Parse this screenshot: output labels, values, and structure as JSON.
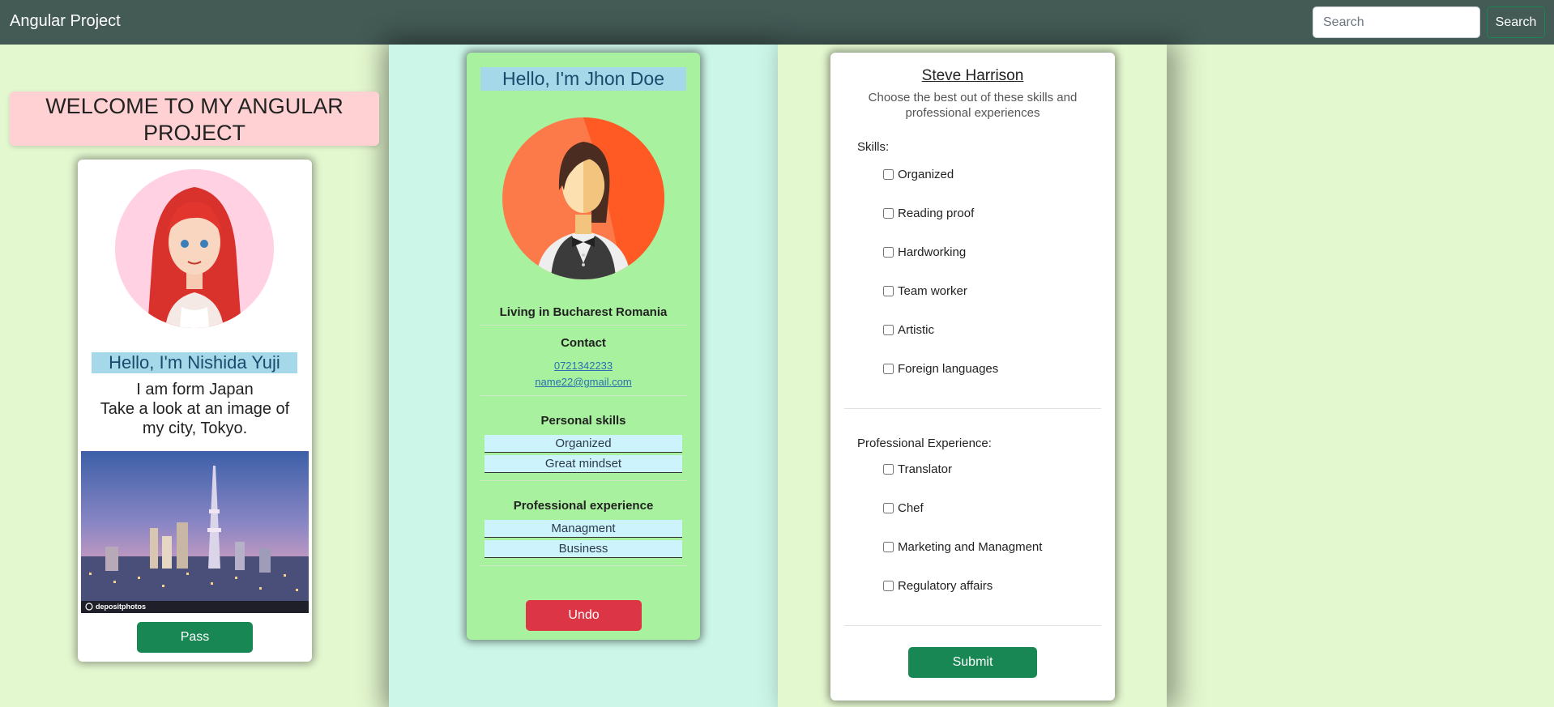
{
  "navbar": {
    "brand": "Angular Project",
    "search_placeholder": "Search",
    "search_button": "Search"
  },
  "left": {
    "welcome": "WELCOME TO MY ANGULAR PROJECT",
    "card": {
      "hello": "Hello, I'm Nishida Yuji",
      "lines": [
        "I am form Japan",
        "Take a look at an image of",
        "my city, Tokyo."
      ],
      "photo_watermark": "depositphotos",
      "pass_button": "Pass"
    }
  },
  "middle": {
    "hello": "Hello, I'm Jhon Doe",
    "location": "Living in Bucharest Romania",
    "contact_heading": "Contact",
    "phone": "0721342233",
    "email": "name22@gmail.com",
    "skills_heading": "Personal skills",
    "skills": [
      "Organized",
      "Great mindset"
    ],
    "experience_heading": "Professional experience",
    "experience": [
      "Managment",
      "Business"
    ],
    "undo_button": "Undo"
  },
  "right": {
    "name": "Steve Harrison",
    "subtitle": "Choose the best out of these skills and professional experiences",
    "skills_label": "Skills:",
    "skills": [
      "Organized",
      "Reading proof",
      "Hardworking",
      "Team worker",
      "Artistic",
      "Foreign languages"
    ],
    "experience_label": "Professional Experience:",
    "experience": [
      "Translator",
      "Chef",
      "Marketing and Managment",
      "Regulatory affairs"
    ],
    "submit_button": "Submit"
  },
  "colors": {
    "navbar": "#435a55",
    "page_bg": "#e4f8d0",
    "middle_col": "#ccf7e8",
    "middle_card": "#a8f29f",
    "welcome_bg": "#ffd1d3",
    "hello_bg": "#a5d8e8",
    "chip_bg": "#cdf3fd",
    "success": "#198754",
    "danger": "#dc3545"
  }
}
